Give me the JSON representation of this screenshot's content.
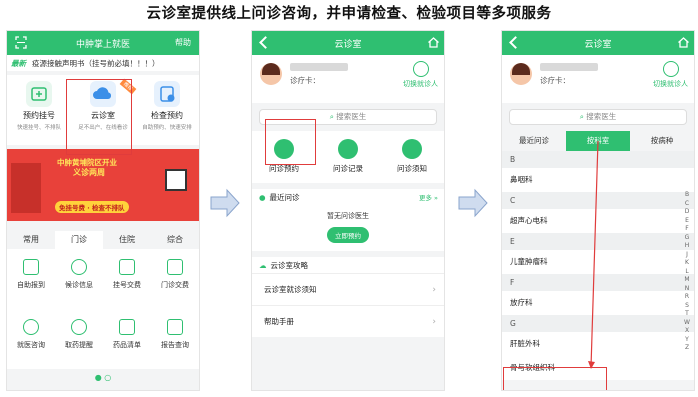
{
  "headline": "云诊室提供线上问诊咨询，并申请检查、检验项目等多项服务",
  "colors": {
    "primary": "#2fbf71",
    "highlight": "#e03c3c",
    "banner": "#e8413a"
  },
  "screen1": {
    "title": "中肿掌上就医",
    "help": "帮助",
    "notice_tag": "最新",
    "notice": "疫源接触声明书（挂号前必填！！！）",
    "tiles": [
      {
        "label": "预约挂号",
        "sub": "快速挂号、不排队"
      },
      {
        "label": "云诊室",
        "sub": "足不出户、在线看诊",
        "badge": "推荐"
      },
      {
        "label": "检查预约",
        "sub": "自助预约、快速安排"
      }
    ],
    "banner": {
      "line1": "中肿黄埔院区开业",
      "line2": "义诊两周",
      "line3": "免挂号费 · 检查不排队"
    },
    "tabs": [
      "常用",
      "门诊",
      "住院",
      "综合"
    ],
    "grid": [
      "自助报到",
      "候诊信息",
      "挂号交费",
      "门诊交费",
      "就医咨询",
      "取药提醒",
      "药品清单",
      "报告查询"
    ]
  },
  "screen2": {
    "title": "云诊室",
    "card_label": "诊疗卡：",
    "switch_label": "切换就诊人",
    "search_placeholder": "搜索医生",
    "quick": [
      "问诊预约",
      "问诊记录",
      "问诊须知"
    ],
    "recent_title": "最近问诊",
    "more": "更多 »",
    "empty_text": "暂无问诊医生",
    "empty_button": "立即预约",
    "guide_title": "云诊室攻略",
    "rows": [
      "云诊室就诊须知",
      "帮助手册"
    ]
  },
  "screen3": {
    "title": "云诊室",
    "card_label": "诊疗卡：",
    "switch_label": "切换就诊人",
    "search_placeholder": "搜索医生",
    "tabs": [
      "最近问诊",
      "按科室",
      "按病种"
    ],
    "departments": [
      {
        "letter": "B",
        "items": [
          "鼻咽科"
        ]
      },
      {
        "letter": "C",
        "items": [
          "超声心电科"
        ]
      },
      {
        "letter": "E",
        "items": [
          "儿童肿瘤科"
        ]
      },
      {
        "letter": "F",
        "items": [
          "放疗科"
        ]
      },
      {
        "letter": "G",
        "items": [
          "肝脏外科",
          "骨与软组织科"
        ]
      }
    ],
    "az": [
      "B",
      "C",
      "D",
      "E",
      "F",
      "G",
      "H",
      "J",
      "K",
      "L",
      "M",
      "N",
      "R",
      "S",
      "T",
      "W",
      "X",
      "Y",
      "Z"
    ]
  }
}
